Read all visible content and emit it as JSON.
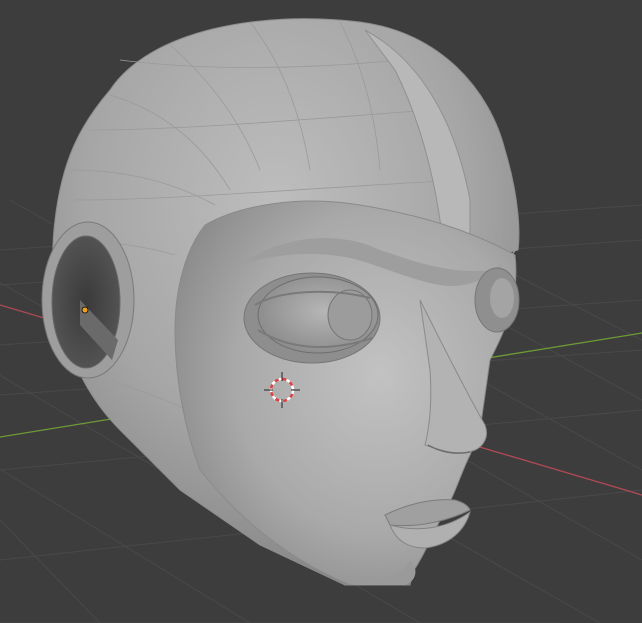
{
  "viewport": {
    "background": "#3d3d3d",
    "grid_color": "#4a4a4a",
    "x_axis_color": "#c0505a",
    "y_axis_color": "#7aa23a",
    "origin_color": "#f0a020",
    "cursor_color": "#e04040"
  },
  "object": {
    "kind": "head-mesh",
    "shading": "solid",
    "base_color": "#a8a8a8"
  }
}
